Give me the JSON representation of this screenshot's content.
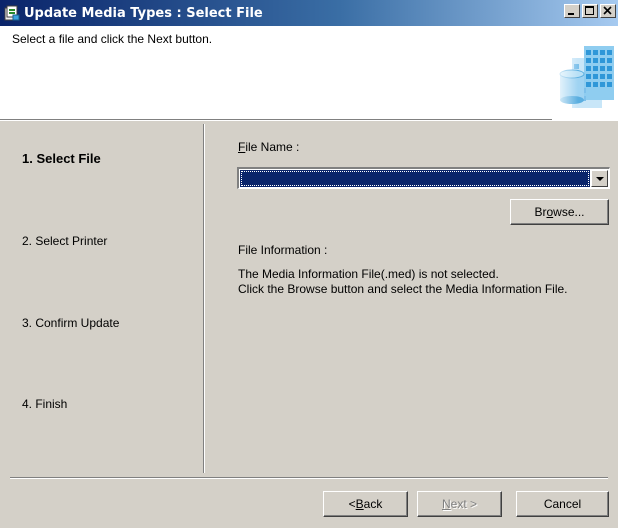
{
  "window": {
    "title": "Update Media Types : Select File",
    "buttons": {
      "minimize": "minimize",
      "maximize": "maximize",
      "close": "close"
    }
  },
  "header": {
    "instruction": "Select a file and click the Next button.",
    "art_icon": "wizard-database-icon"
  },
  "steps": [
    {
      "label": "1. Select File",
      "active": true
    },
    {
      "label": "2. Select Printer",
      "active": false
    },
    {
      "label": "3. Confirm Update",
      "active": false
    },
    {
      "label": "4. Finish",
      "active": false
    }
  ],
  "form": {
    "file_name_label_mnemonic": "F",
    "file_name_label_rest": "ile Name :",
    "file_name_value": "",
    "browse_pre": "Br",
    "browse_mnemonic": "o",
    "browse_post": "wse...",
    "file_info_label": "File Information :",
    "file_info_line1": "The Media Information File(.med) is not selected.",
    "file_info_line2": "Click the Browse button and select the Media Information File."
  },
  "footer": {
    "back_pre": "< ",
    "back_mnemonic": "B",
    "back_post": "ack",
    "next_mnemonic": "N",
    "next_post": "ext >",
    "next_disabled": true,
    "cancel_label": "Cancel"
  },
  "colors": {
    "face": "#d4d0c8",
    "title_start": "#0a246a",
    "title_end": "#a6caf0",
    "selection": "#0a246a"
  }
}
